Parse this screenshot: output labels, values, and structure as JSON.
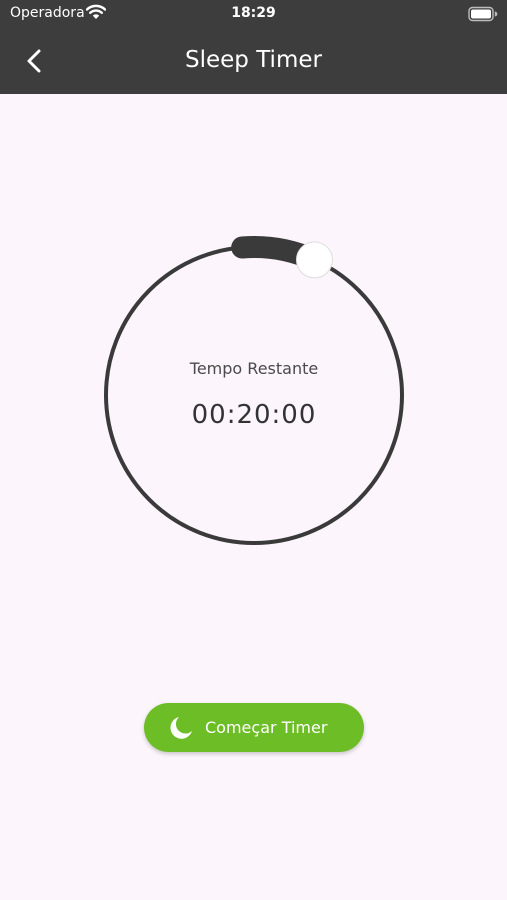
{
  "status_bar": {
    "carrier": "Operadora",
    "time": "18:29",
    "wifi_icon": "wifi-icon",
    "battery_icon": "battery-icon"
  },
  "header": {
    "back_icon": "chevron-left-icon",
    "title": "Sleep Timer"
  },
  "timer": {
    "label": "Tempo Restante",
    "remaining": "00:20:00",
    "progress_fraction": 0.067
  },
  "start_button": {
    "icon": "moon-icon",
    "label": "Começar Timer"
  },
  "colors": {
    "app_bar": "#3d3d3d",
    "background": "#fcf5fc",
    "ring": "#3a3a3a",
    "accent_green": "#6dbd27"
  }
}
